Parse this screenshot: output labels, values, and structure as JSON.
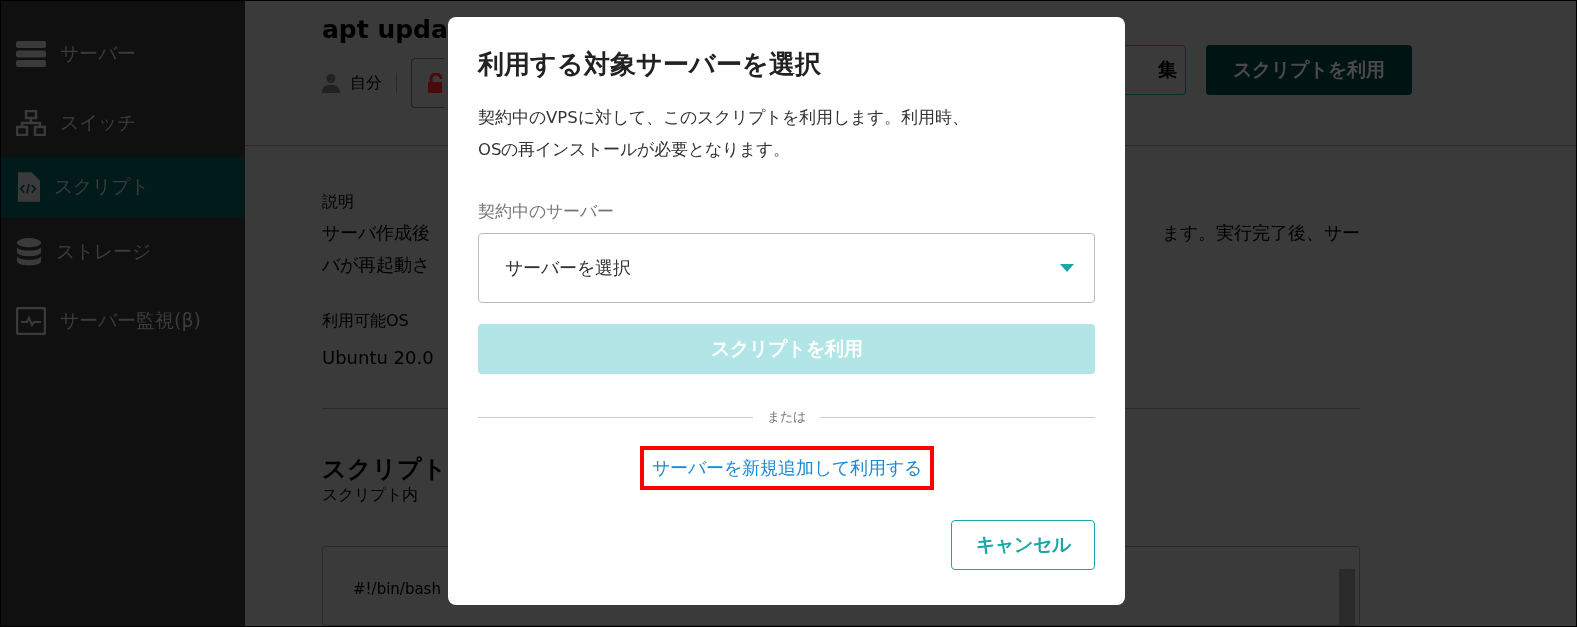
{
  "sidebar": {
    "items": [
      {
        "label": "サーバー",
        "selected": false
      },
      {
        "label": "スイッチ",
        "selected": false
      },
      {
        "label": "スクリプト",
        "selected": true
      },
      {
        "label": "ストレージ",
        "selected": false
      },
      {
        "label": "サーバー監視(β)",
        "selected": false
      }
    ]
  },
  "page": {
    "title": "apt upda",
    "owner": "自分",
    "edit_button": "集",
    "use_button": "スクリプトを利用",
    "description_label": "説明",
    "description_left": [
      "サーバ作成後",
      "バが再起動さ"
    ],
    "description_right": "ます。実行完了後、サー",
    "os_label": "利用可能OS",
    "os_value": "Ubuntu 20.0",
    "section_title": "スクリプト",
    "content_label": "スクリプト内",
    "code_line": "#!/bin/bash"
  },
  "dialog": {
    "title": "利用する対象サーバーを選択",
    "text": [
      "契約中のVPSに対して、このスクリプトを利用します。利用時、",
      "OSの再インストールが必要となります。"
    ],
    "select_label": "契約中のサーバー",
    "select_value": "サーバーを選択",
    "submit": {
      "label": "スクリプトを利用",
      "disabled": true
    },
    "separator": "または",
    "link": {
      "label": "サーバーを新規追加して利用する",
      "highlighted": true
    },
    "cancel": "キャンセル"
  }
}
